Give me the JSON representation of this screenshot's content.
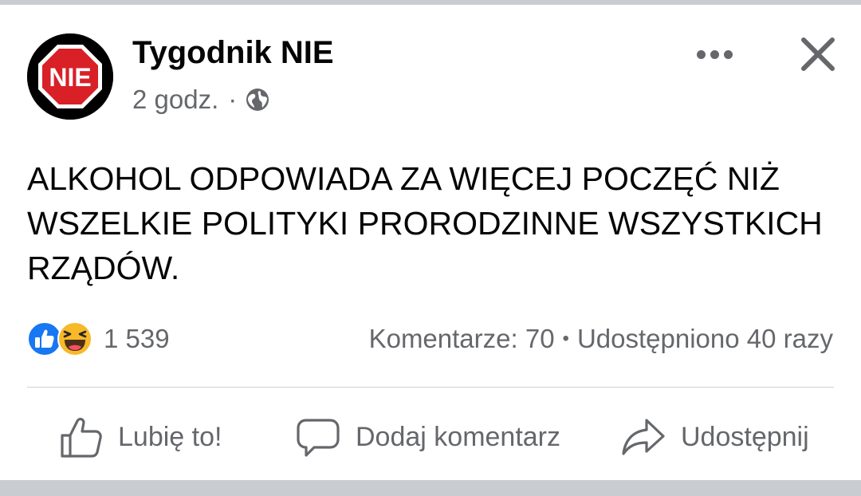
{
  "post": {
    "author": "Tygodnik NIE",
    "avatar_text": "NIE",
    "time": "2 godz.",
    "separator": "·",
    "privacy_icon": "globe-icon",
    "text": "ALKOHOL ODPOWIADA ZA WIĘCEJ POCZĘĆ NIŻ WSZELKIE POLITYKI PRORODZINNE WSZYSTKICH RZĄDÓW."
  },
  "stats": {
    "reaction_icons": [
      "like-icon",
      "haha-icon"
    ],
    "reaction_count": "1 539",
    "comments": "Komentarze: 70",
    "bullet": "•",
    "shares": "Udostępniono 40 razy"
  },
  "actions": {
    "like": "Lubię to!",
    "comment": "Dodaj komentarz",
    "share": "Udostępnij"
  },
  "colors": {
    "primary_text": "#050505",
    "secondary_text": "#65676b",
    "like_blue": "#1877f2",
    "haha_yellow": "#f7b928",
    "avatar_red": "#d92027",
    "background": "#c9ccd1"
  }
}
